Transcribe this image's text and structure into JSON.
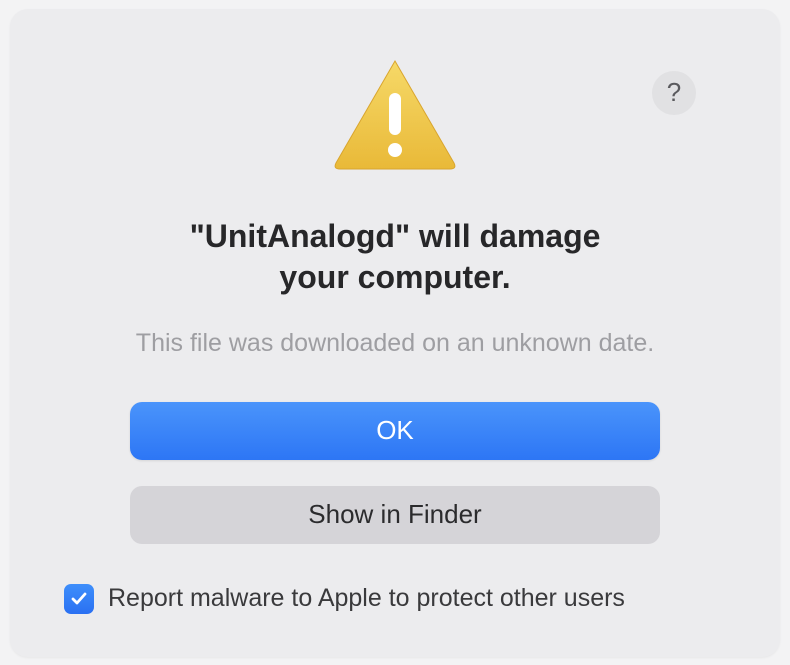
{
  "dialog": {
    "title_line1": "\"UnitAnalogd\" will damage",
    "title_line2": "your computer.",
    "subtitle": "This file was downloaded on an unknown date.",
    "primary_button": "OK",
    "secondary_button": "Show in Finder",
    "checkbox_label": "Report malware to Apple to protect other users",
    "checkbox_checked": true,
    "help_label": "?"
  },
  "colors": {
    "primary_blue": "#2d76f5",
    "background": "#ECECEE"
  }
}
